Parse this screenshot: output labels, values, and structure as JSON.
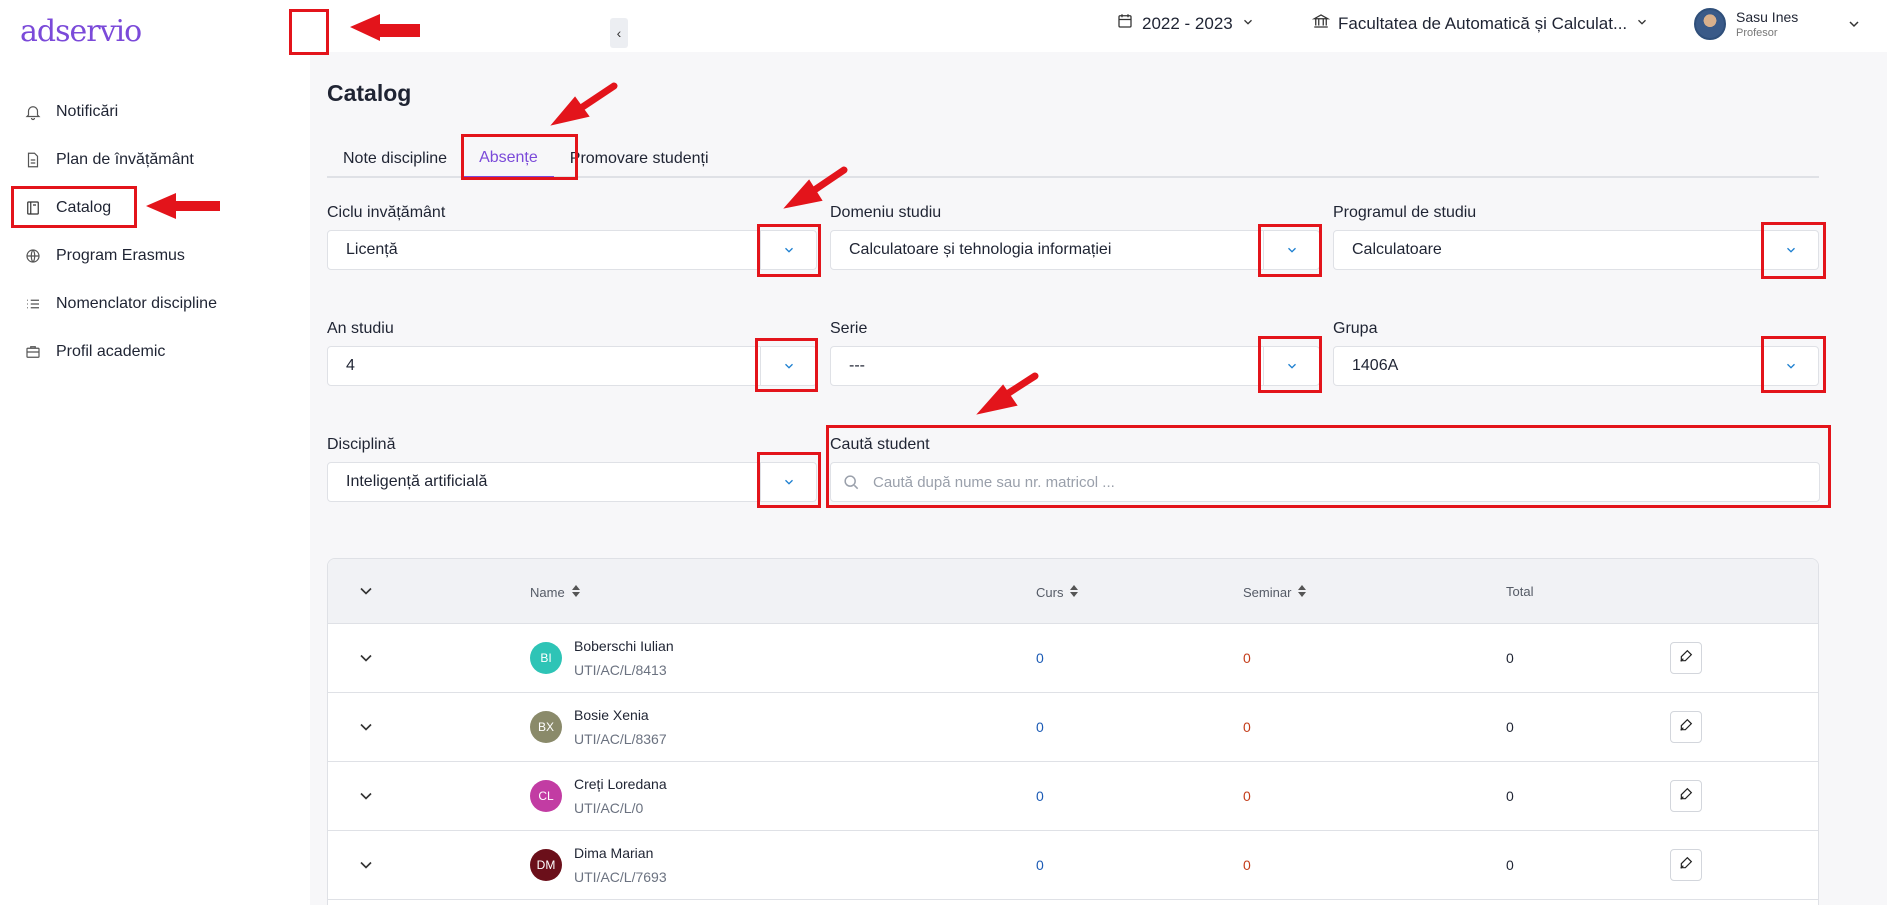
{
  "app": {
    "logo": "adservio"
  },
  "sidebar": {
    "items": [
      {
        "label": "Notificări",
        "icon": "bell-icon"
      },
      {
        "label": "Plan de învățământ",
        "icon": "document-icon"
      },
      {
        "label": "Catalog",
        "icon": "book-icon"
      },
      {
        "label": "Program Erasmus",
        "icon": "globe-icon"
      },
      {
        "label": "Nomenclator discipline",
        "icon": "list-icon"
      },
      {
        "label": "Profil academic",
        "icon": "briefcase-icon"
      }
    ]
  },
  "topbar": {
    "collapse_glyph": "‹",
    "year": "2022 - 2023",
    "faculty": "Facultatea de Automatică și Calculat...",
    "user_name": "Sasu Ines",
    "user_role": "Profesor"
  },
  "page": {
    "title": "Catalog",
    "tabs": [
      "Note discipline",
      "Absențe",
      "Promovare studenți"
    ],
    "active_tab": "Absențe"
  },
  "filters": {
    "ciclu": {
      "label": "Ciclu invățământ",
      "value": "Licență"
    },
    "domeniu": {
      "label": "Domeniu studiu",
      "value": "Calculatoare și tehnologia informației"
    },
    "program": {
      "label": "Programul de studiu",
      "value": "Calculatoare"
    },
    "an": {
      "label": "An studiu",
      "value": "4"
    },
    "serie": {
      "label": "Serie",
      "value": "---"
    },
    "grupa": {
      "label": "Grupa",
      "value": "1406A"
    },
    "disciplina": {
      "label": "Disciplină",
      "value": "Inteligență artificială"
    },
    "search": {
      "label": "Caută student",
      "placeholder": "Caută după nume sau nr. matricol ..."
    }
  },
  "table": {
    "headers": {
      "name": "Name",
      "curs": "Curs",
      "seminar": "Seminar",
      "total": "Total"
    },
    "rows": [
      {
        "initials": "BI",
        "name": "Boberschi Iulian",
        "matricol": "UTI/AC/L/8413",
        "curs": "0",
        "seminar": "0",
        "total": "0",
        "avatar_color": "#2ec4b6"
      },
      {
        "initials": "BX",
        "name": "Bosie Xenia",
        "matricol": "UTI/AC/L/8367",
        "curs": "0",
        "seminar": "0",
        "total": "0",
        "avatar_color": "#8a8a6a"
      },
      {
        "initials": "CL",
        "name": "Creți Loredana",
        "matricol": "UTI/AC/L/0",
        "curs": "0",
        "seminar": "0",
        "total": "0",
        "avatar_color": "#c23ca3"
      },
      {
        "initials": "DM",
        "name": "Dima Marian",
        "matricol": "UTI/AC/L/7693",
        "curs": "0",
        "seminar": "0",
        "total": "0",
        "avatar_color": "#6b0f1a"
      }
    ]
  },
  "colors": {
    "accent": "#7b4ad9",
    "highlight": "#e3141b",
    "curs": "#1c5bb5",
    "seminar": "#c43d1a"
  }
}
